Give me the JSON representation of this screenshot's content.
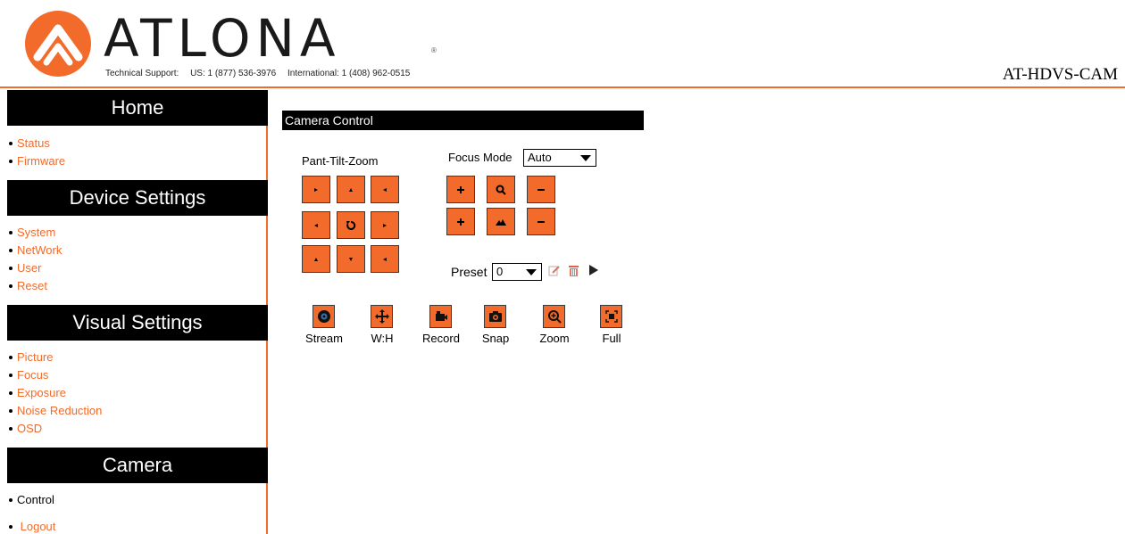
{
  "header": {
    "logo_text": "ATLONA",
    "logo_reg": "®",
    "support_label": "Technical Support:",
    "support_us": "US: 1 (877) 536-3976",
    "support_intl": "International: 1 (408) 962-0515",
    "model": "AT-HDVS-CAM"
  },
  "sidebar": {
    "sections": [
      {
        "title": "Home",
        "items": [
          "Status",
          "Firmware"
        ]
      },
      {
        "title": "Device Settings",
        "items": [
          "System",
          "NetWork",
          "User",
          "Reset"
        ]
      },
      {
        "title": "Visual Settings",
        "items": [
          "Picture",
          "Focus",
          "Exposure",
          "Noise Reduction",
          "OSD"
        ]
      },
      {
        "title": "Camera",
        "items": [
          "Control"
        ]
      }
    ],
    "logout": "Logout"
  },
  "main": {
    "title": "Camera Control",
    "ptz_label": "Pant-Tilt-Zoom",
    "focus_mode_label": "Focus Mode",
    "focus_mode_value": "Auto",
    "preset_label": "Preset",
    "preset_value": "0",
    "tools": [
      "Stream",
      "W:H",
      "Record",
      "Snap",
      "Zoom",
      "Full"
    ]
  },
  "colors": {
    "accent": "#f26b2a",
    "section_bg": "#000000",
    "button_border": "#3a3a3a"
  }
}
